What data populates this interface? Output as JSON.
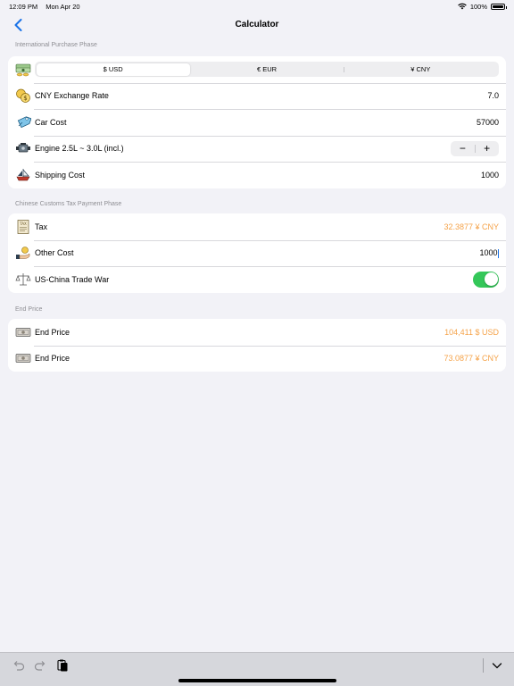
{
  "status_bar": {
    "time": "12:09 PM",
    "date": "Mon Apr 20",
    "battery": "100%"
  },
  "nav": {
    "title": "Calculator",
    "back_icon": "chevron-left-icon"
  },
  "purchase": {
    "header": "International Purchase Phase",
    "currency_segments": [
      "$ USD",
      "€ EUR",
      "¥ CNY"
    ],
    "selected_currency": "$ USD",
    "exchange_label": "CNY Exchange Rate",
    "exchange_value": "7.0",
    "car_cost_label": "Car Cost",
    "car_cost_value": "57000",
    "engine_label": "Engine 2.5L ~ 3.0L (incl.)",
    "stepper_minus": "−",
    "stepper_plus": "+",
    "shipping_label": "Shipping Cost",
    "shipping_value": "1000"
  },
  "customs": {
    "header": "Chinese Customs Tax Payment Phase",
    "tax_label": "Tax",
    "tax_value": "32.3877 ¥ CNY",
    "other_label": "Other Cost",
    "other_value": "1000",
    "trade_war_label": "US-China Trade War",
    "trade_war_on": true
  },
  "end": {
    "header": "End Price",
    "usd_label": "End Price",
    "usd_value": "104,411 $ USD",
    "cny_label": "End Price",
    "cny_value": "73.0877 ¥ CNY"
  },
  "colors": {
    "accent": "#1a73e8",
    "orange": "#f5a34a",
    "toggle_on": "#34c759",
    "background": "#f2f2f7"
  }
}
